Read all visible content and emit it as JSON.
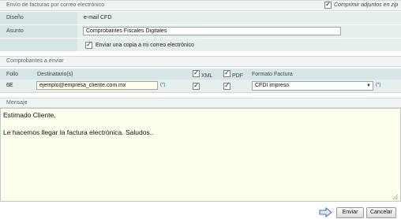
{
  "envio": {
    "title": "Envío de facturas por correo electrónico",
    "compress_label": "Comprimir adjuntos en zip",
    "compress_checked": true,
    "design_label": "Diseño",
    "design_value": "e-mail CFD",
    "subject_label": "Asunto",
    "subject_value": "Comprobantes Fiscales Digitales",
    "copy_label": "Enviar una copia a mi correo electrónico",
    "copy_checked": true
  },
  "comprobantes": {
    "title": "Comprobantes a enviar",
    "columns": {
      "folio": "Folio",
      "recipients": "Destinatario(s)",
      "xml": "XML",
      "pdf": "PDF",
      "format": "Formato Factura"
    },
    "row": {
      "folio": "6E",
      "email": "ejemplo@empresa_cliente.com.mx",
      "email_marker": "(*)",
      "xml_checked": true,
      "pdf_checked": true,
      "format": "CFDI impreso",
      "format_marker": "(*)"
    }
  },
  "mensaje": {
    "title": "Mensaje",
    "body": "Estimado Cliente,\n\nLe hacemos llegar la factura electrónica. Saludos.."
  },
  "actions": {
    "send_label": "Enviar",
    "cancel_label": "Cancelar",
    "send_icon": "arrow-right-icon"
  },
  "colors": {
    "label_bg": "#d6e6e6",
    "value_bg": "#e6eeee",
    "message_bg": "#ffffee",
    "arrow_color": "#4a78c0"
  }
}
